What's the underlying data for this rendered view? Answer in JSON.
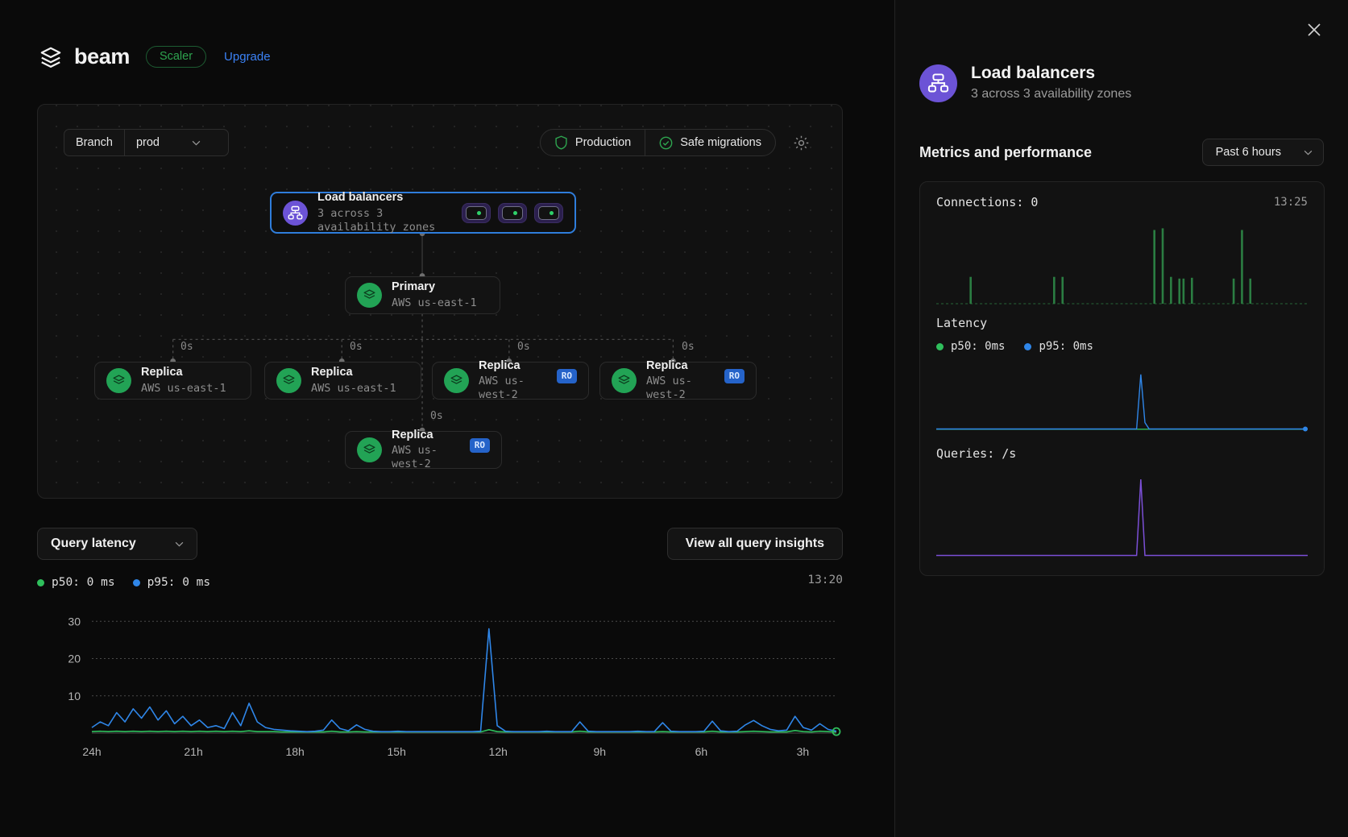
{
  "brand": {
    "name": "beam",
    "plan": "Scaler",
    "upgrade": "Upgrade",
    "logo_icon": "layers-icon"
  },
  "topology": {
    "branch_label": "Branch",
    "branch_value": "prod",
    "status": [
      {
        "label": "Production",
        "icon": "shield-icon",
        "color": "#2ea44f"
      },
      {
        "label": "Safe migrations",
        "icon": "check-circle-icon",
        "color": "#2ea44f"
      }
    ],
    "settings_icon": "gear-icon",
    "load_balancer": {
      "title": "Load balancers",
      "subtitle": "3 across 3 availability zones",
      "icon": "load-balancer-icon",
      "chips": [
        {
          "status_color": "#2fd16a"
        },
        {
          "status_color": "#2fd16a"
        },
        {
          "status_color": "#2fd16a"
        }
      ]
    },
    "primary": {
      "title": "Primary",
      "region": "AWS us-east-1",
      "icon": "database-icon"
    },
    "replicas": [
      {
        "title": "Replica",
        "region": "AWS us-east-1",
        "badge": "",
        "lag": "0s"
      },
      {
        "title": "Replica",
        "region": "AWS us-east-1",
        "badge": "",
        "lag": "0s"
      },
      {
        "title": "Replica",
        "region": "AWS us-west-2",
        "badge": "RO",
        "lag": "0s"
      },
      {
        "title": "Replica",
        "region": "AWS us-west-2",
        "badge": "RO",
        "lag": "0s"
      },
      {
        "title": "Replica",
        "region": "AWS us-west-2",
        "badge": "RO",
        "lag": "0s"
      }
    ]
  },
  "query_latency": {
    "select_label": "Query latency",
    "insights_button": "View all query insights",
    "legend": [
      {
        "label": "p50: 0 ms",
        "color": "#2fbf5c"
      },
      {
        "label": "p95: 0 ms",
        "color": "#2f86e8"
      }
    ],
    "timestamp": "13:20"
  },
  "panel": {
    "close_icon": "close-icon",
    "title": "Load balancers",
    "subtitle": "3 across 3 availability zones",
    "icon": "load-balancer-icon",
    "metrics_title": "Metrics and performance",
    "range": "Past 6 hours",
    "connections": {
      "label": "Connections: 0",
      "timestamp": "13:25"
    },
    "latency": {
      "label": "Latency",
      "legend": [
        {
          "label": "p50: 0ms",
          "color": "#2fbf5c"
        },
        {
          "label": "p95: 0ms",
          "color": "#2f86e8"
        }
      ]
    },
    "queries": {
      "label": "Queries: /s"
    }
  },
  "chart_data": [
    {
      "id": "query-latency-main",
      "type": "line",
      "title": "Query latency",
      "xlabel": "",
      "ylabel": "",
      "ylim": [
        0,
        32
      ],
      "yticks": [
        0,
        10,
        20,
        30
      ],
      "xticks": [
        "24h",
        "21h",
        "18h",
        "15h",
        "12h",
        "9h",
        "6h",
        "3h"
      ],
      "grid": true,
      "legend_position": "top-left",
      "series": [
        {
          "name": "p95: 0 ms",
          "color": "#2f86e8",
          "values": [
            1.5,
            3,
            2,
            5.5,
            3,
            6.5,
            4,
            7,
            3.5,
            6,
            2.5,
            4.5,
            2,
            3.5,
            1.5,
            2,
            1.2,
            5.5,
            2,
            8,
            3,
            1.5,
            1,
            0.8,
            0.6,
            0.5,
            0.4,
            0.5,
            0.8,
            3.5,
            1.2,
            0.6,
            2.2,
            1.0,
            0.5,
            0.4,
            0.4,
            0.5,
            0.4,
            0.4,
            0.4,
            0.4,
            0.4,
            0.4,
            0.4,
            0.4,
            0.4,
            0.5,
            28,
            2.0,
            0.5,
            0.4,
            0.4,
            0.4,
            0.4,
            0.5,
            0.4,
            0.4,
            0.4,
            3.0,
            0.5,
            0.4,
            0.4,
            0.4,
            0.4,
            0.4,
            0.5,
            0.4,
            0.4,
            2.8,
            0.5,
            0.4,
            0.4,
            0.4,
            0.5,
            3.2,
            0.6,
            0.4,
            0.5,
            2.2,
            3.4,
            2.0,
            1.0,
            0.6,
            0.8,
            4.5,
            1.5,
            0.8,
            2.5,
            1.0,
            0.5
          ]
        },
        {
          "name": "p50: 0 ms",
          "color": "#2fbf5c",
          "values": [
            0.4,
            0.5,
            0.4,
            0.5,
            0.4,
            0.5,
            0.4,
            0.5,
            0.4,
            0.5,
            0.4,
            0.5,
            0.4,
            0.5,
            0.4,
            0.5,
            0.4,
            0.5,
            0.4,
            0.6,
            0.4,
            0.4,
            0.4,
            0.3,
            0.3,
            0.3,
            0.3,
            0.3,
            0.3,
            0.5,
            0.3,
            0.3,
            0.4,
            0.3,
            0.3,
            0.3,
            0.3,
            0.3,
            0.3,
            0.3,
            0.3,
            0.3,
            0.3,
            0.3,
            0.3,
            0.3,
            0.3,
            0.3,
            0.9,
            0.4,
            0.3,
            0.3,
            0.3,
            0.3,
            0.3,
            0.3,
            0.3,
            0.3,
            0.3,
            0.5,
            0.3,
            0.3,
            0.3,
            0.3,
            0.3,
            0.3,
            0.3,
            0.3,
            0.3,
            0.4,
            0.3,
            0.3,
            0.3,
            0.3,
            0.3,
            0.5,
            0.3,
            0.3,
            0.3,
            0.4,
            0.5,
            0.4,
            0.3,
            0.3,
            0.3,
            0.7,
            0.4,
            0.3,
            0.5,
            0.4,
            0.3
          ]
        }
      ],
      "end_marker": {
        "color": "#2fbf5c"
      }
    },
    {
      "id": "panel-connections",
      "type": "bar",
      "title": "Connections: 0",
      "ylim": [
        0,
        10
      ],
      "grid": false,
      "color": "#2b7d42",
      "values": [
        0,
        0,
        0,
        0,
        0,
        0,
        0,
        0,
        3.2,
        0,
        0,
        0,
        0,
        0,
        0,
        0,
        0,
        0,
        0,
        0,
        0,
        0,
        0,
        0,
        0,
        0,
        0,
        0,
        3.2,
        0,
        3.2,
        0,
        0,
        0,
        0,
        0,
        0,
        0,
        0,
        0,
        0,
        0,
        0,
        0,
        0,
        0,
        0,
        0,
        0,
        0,
        0,
        0,
        8.8,
        0,
        9.0,
        0,
        3.2,
        0,
        3.0,
        3.0,
        0,
        3.1,
        0,
        0,
        0,
        0,
        0,
        0,
        0,
        0,
        0,
        3.0,
        0,
        8.8,
        0,
        3.0,
        0,
        0,
        0,
        0,
        0,
        0,
        0,
        0,
        0,
        0,
        0,
        0,
        0
      ]
    },
    {
      "id": "panel-latency",
      "type": "line",
      "title": "Latency",
      "ylim": [
        0,
        32
      ],
      "grid": false,
      "series": [
        {
          "name": "p95: 0ms",
          "color": "#2f86e8",
          "values": [
            0.2,
            0.2,
            0.2,
            0.2,
            0.2,
            0.2,
            0.2,
            0.2,
            0.2,
            0.2,
            0.2,
            0.2,
            0.2,
            0.2,
            0.2,
            0.2,
            0.2,
            0.2,
            0.2,
            0.2,
            0.2,
            0.2,
            0.2,
            0.2,
            0.2,
            0.2,
            0.2,
            0.2,
            0.2,
            0.2,
            0.2,
            0.2,
            0.2,
            0.2,
            0.2,
            0.2,
            0.2,
            0.2,
            0.2,
            0.2,
            0.2,
            0.2,
            0.2,
            0.2,
            0.2,
            0.2,
            0.2,
            0.2,
            0.2,
            28,
            3.5,
            0.2,
            0.2,
            0.2,
            0.2,
            0.2,
            0.2,
            0.2,
            0.2,
            0.2,
            0.2,
            0.2,
            0.2,
            0.2,
            0.2,
            0.2,
            0.2,
            0.2,
            0.2,
            0.2,
            0.2,
            0.2,
            0.2,
            0.2,
            0.2,
            0.2,
            0.2,
            0.2,
            0.2,
            0.2,
            0.2,
            0.2,
            0.2,
            0.2,
            0.2,
            0.2,
            0.2,
            0.2,
            0.2,
            0.2
          ]
        },
        {
          "name": "p50: 0ms",
          "color": "#2fbf5c",
          "values": [
            0.1,
            0.1,
            0.1,
            0.1,
            0.1,
            0.1,
            0.1,
            0.1,
            0.1,
            0.1,
            0.1,
            0.1,
            0.1,
            0.1,
            0.1,
            0.1,
            0.1,
            0.1,
            0.1,
            0.1,
            0.1,
            0.1,
            0.1,
            0.1,
            0.1,
            0.1,
            0.1,
            0.1,
            0.1,
            0.1,
            0.1,
            0.1,
            0.1,
            0.1,
            0.1,
            0.1,
            0.1,
            0.1,
            0.1,
            0.1,
            0.1,
            0.1,
            0.1,
            0.1,
            0.1,
            0.1,
            0.1,
            0.1,
            0.1,
            0.1,
            0.1,
            0.1,
            0.1,
            0.1,
            0.1,
            0.1,
            0.1,
            0.1,
            0.1,
            0.1,
            0.1,
            0.1,
            0.1,
            0.1,
            0.1,
            0.1,
            0.1,
            0.1,
            0.1,
            0.1,
            0.1,
            0.1,
            0.1,
            0.1,
            0.1,
            0.1,
            0.1,
            0.1,
            0.1,
            0.1,
            0.1,
            0.1,
            0.1,
            0.1,
            0.1,
            0.1,
            0.1,
            0.1,
            0.1,
            0.1
          ]
        }
      ],
      "end_marker": {
        "color": "#2f86e8"
      }
    },
    {
      "id": "panel-queries",
      "type": "line",
      "title": "Queries: /s",
      "ylim": [
        0,
        10
      ],
      "grid": false,
      "color": "#7b4fd6",
      "values": [
        0.05,
        0.05,
        0.05,
        0.05,
        0.05,
        0.05,
        0.05,
        0.05,
        0.05,
        0.05,
        0.05,
        0.05,
        0.05,
        0.05,
        0.05,
        0.05,
        0.05,
        0.05,
        0.05,
        0.05,
        0.05,
        0.05,
        0.05,
        0.05,
        0.05,
        0.05,
        0.05,
        0.05,
        0.05,
        0.05,
        0.05,
        0.05,
        0.05,
        0.05,
        0.05,
        0.05,
        0.05,
        0.05,
        0.05,
        0.05,
        0.05,
        0.05,
        0.05,
        0.05,
        0.05,
        0.05,
        0.05,
        0.05,
        0.05,
        9.5,
        0.05,
        0.05,
        0.05,
        0.05,
        0.05,
        0.05,
        0.05,
        0.05,
        0.05,
        0.05,
        0.05,
        0.05,
        0.05,
        0.05,
        0.05,
        0.05,
        0.05,
        0.05,
        0.05,
        0.05,
        0.05,
        0.05,
        0.05,
        0.05,
        0.05,
        0.05,
        0.05,
        0.05,
        0.05,
        0.05,
        0.05,
        0.05,
        0.05,
        0.05,
        0.05,
        0.05,
        0.05,
        0.05,
        0.05,
        0.05
      ]
    }
  ]
}
